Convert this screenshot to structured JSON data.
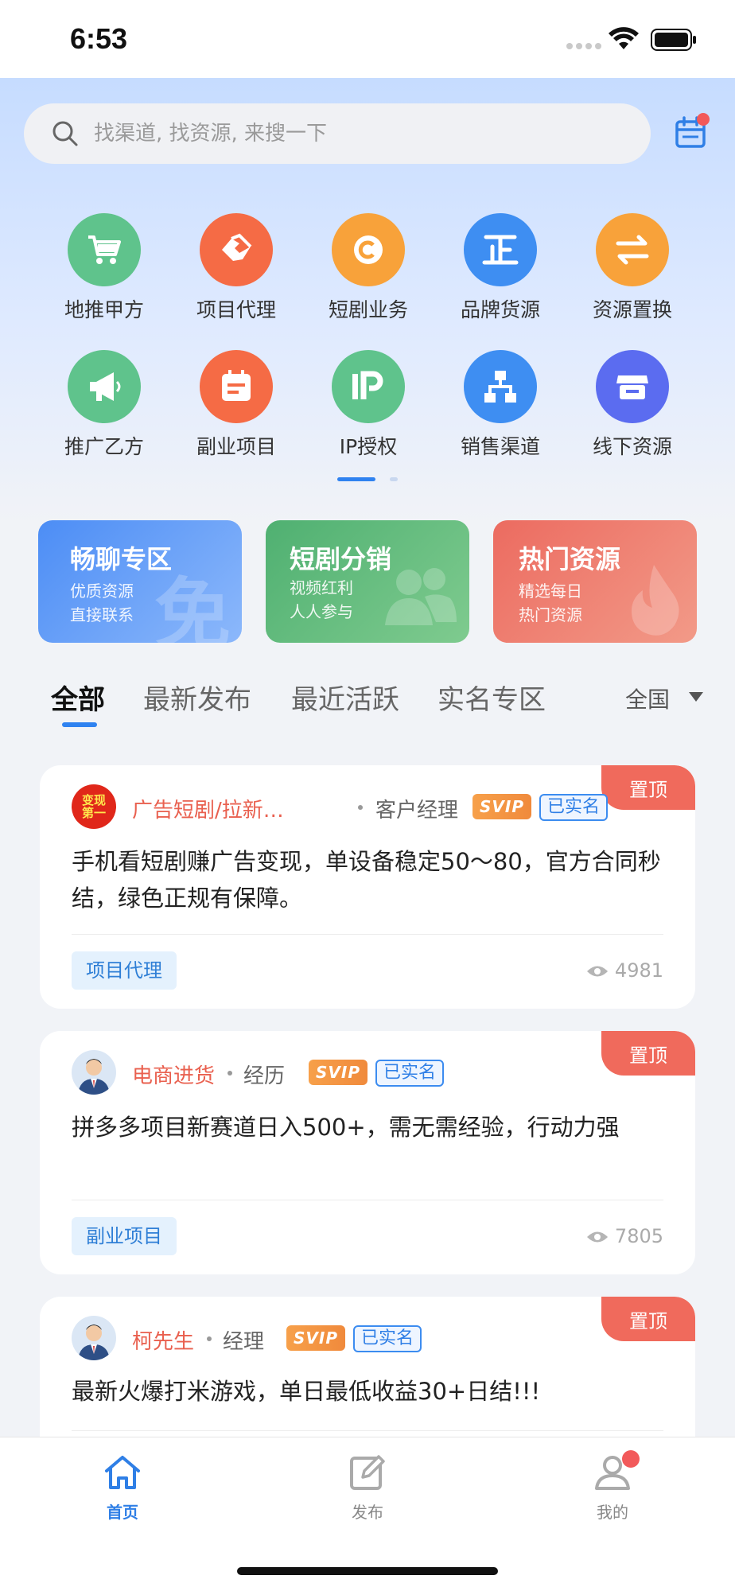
{
  "status_bar": {
    "time": "6:53"
  },
  "search": {
    "placeholder": "找渠道, 找资源, 来搜一下"
  },
  "categories": [
    {
      "label": "地推甲方",
      "icon": "cart-icon",
      "color": "#5fc38c"
    },
    {
      "label": "项目代理",
      "icon": "handshake-icon",
      "color": "#f56b45"
    },
    {
      "label": "短剧业务",
      "icon": "copyright-icon",
      "color": "#f8a23a"
    },
    {
      "label": "品牌货源",
      "icon": "zheng-icon",
      "color": "#3e8ef2"
    },
    {
      "label": "资源置换",
      "icon": "swap-icon",
      "color": "#f8a23a"
    },
    {
      "label": "推广乙方",
      "icon": "megaphone-icon",
      "color": "#5fc38c"
    },
    {
      "label": "副业项目",
      "icon": "calendar-icon",
      "color": "#f56b45"
    },
    {
      "label": "IP授权",
      "icon": "ip-icon",
      "color": "#5fc38c"
    },
    {
      "label": "销售渠道",
      "icon": "org-chart-icon",
      "color": "#3e8ef2"
    },
    {
      "label": "线下资源",
      "icon": "store-icon",
      "color": "#5b6cf0"
    }
  ],
  "promos": [
    {
      "title": "畅聊专区",
      "line1": "优质资源",
      "line2": "直接联系",
      "art": "免"
    },
    {
      "title": "短剧分销",
      "line1": "视频红利",
      "line2": "人人参与"
    },
    {
      "title": "热门资源",
      "line1": "精选每日",
      "line2": "热门资源"
    }
  ],
  "tabs": [
    "全部",
    "最新发布",
    "最近活跃",
    "实名专区"
  ],
  "region": "全国",
  "feed": [
    {
      "pin": "置顶",
      "avatar_text": [
        "变现",
        "第一"
      ],
      "author": "广告短剧/拉新…",
      "role": "客户经理",
      "svip": "SVIP",
      "verified": "已实名",
      "body": "手机看短剧赚广告变现，单设备稳定50～80，官方合同秒结，绿色正规有保障。",
      "tag": "项目代理",
      "views": "4981"
    },
    {
      "pin": "置顶",
      "author": "电商进货",
      "role": "经历",
      "svip": "SVIP",
      "verified": "已实名",
      "body": "拼多多项目新赛道日入500+，需无需经验，行动力强",
      "tag": "副业项目",
      "views": "7805"
    },
    {
      "pin": "置顶",
      "author": "柯先生",
      "role": "经理",
      "svip": "SVIP",
      "verified": "已实名",
      "body": "最新火爆打米游戏，单日最低收益30+日结!!!"
    }
  ],
  "bottom_nav": [
    {
      "label": "首页",
      "icon": "home-icon",
      "active": true
    },
    {
      "label": "发布",
      "icon": "edit-icon",
      "active": false
    },
    {
      "label": "我的",
      "icon": "user-icon",
      "active": false
    }
  ],
  "colors": {
    "accent": "#2f82f0",
    "pin": "#f06a5c",
    "author": "#e9604f"
  }
}
